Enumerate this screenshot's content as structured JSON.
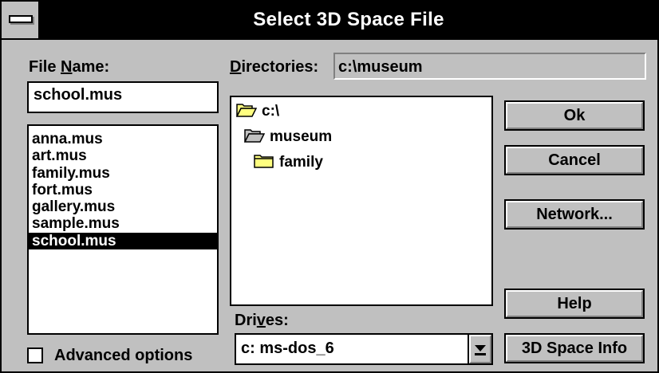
{
  "window": {
    "title": "Select 3D Space File",
    "system_menu_icon": "system-menu-icon"
  },
  "file_name": {
    "label_before": "File ",
    "label_accel": "N",
    "label_after": "ame:",
    "value": "school.mus"
  },
  "files": {
    "items": [
      "anna.mus",
      "art.mus",
      "family.mus",
      "fort.mus",
      "gallery.mus",
      "sample.mus",
      "school.mus"
    ],
    "selected": "school.mus"
  },
  "directories": {
    "label_accel": "D",
    "label_after": "irectories:",
    "current_path": "c:\\museum",
    "tree": [
      {
        "name": "c:\\",
        "icon": "open-folder-icon"
      },
      {
        "name": "museum",
        "icon": "open-folder-icon"
      },
      {
        "name": "family",
        "icon": "folder-icon"
      }
    ]
  },
  "drives": {
    "label_before": "Dri",
    "label_accel": "v",
    "label_after": "es:",
    "selected": "c: ms-dos_6"
  },
  "advanced_options": {
    "label": "Advanced options",
    "checked": false
  },
  "buttons": {
    "ok": "Ok",
    "cancel": "Cancel",
    "network": "Network...",
    "help": "Help",
    "info": "3D Space Info"
  },
  "colors": {
    "face": "#c0c0c0",
    "shadow": "#808080",
    "highlight": "#ffffff",
    "folder": "#ffff80",
    "selection": "#000000"
  }
}
